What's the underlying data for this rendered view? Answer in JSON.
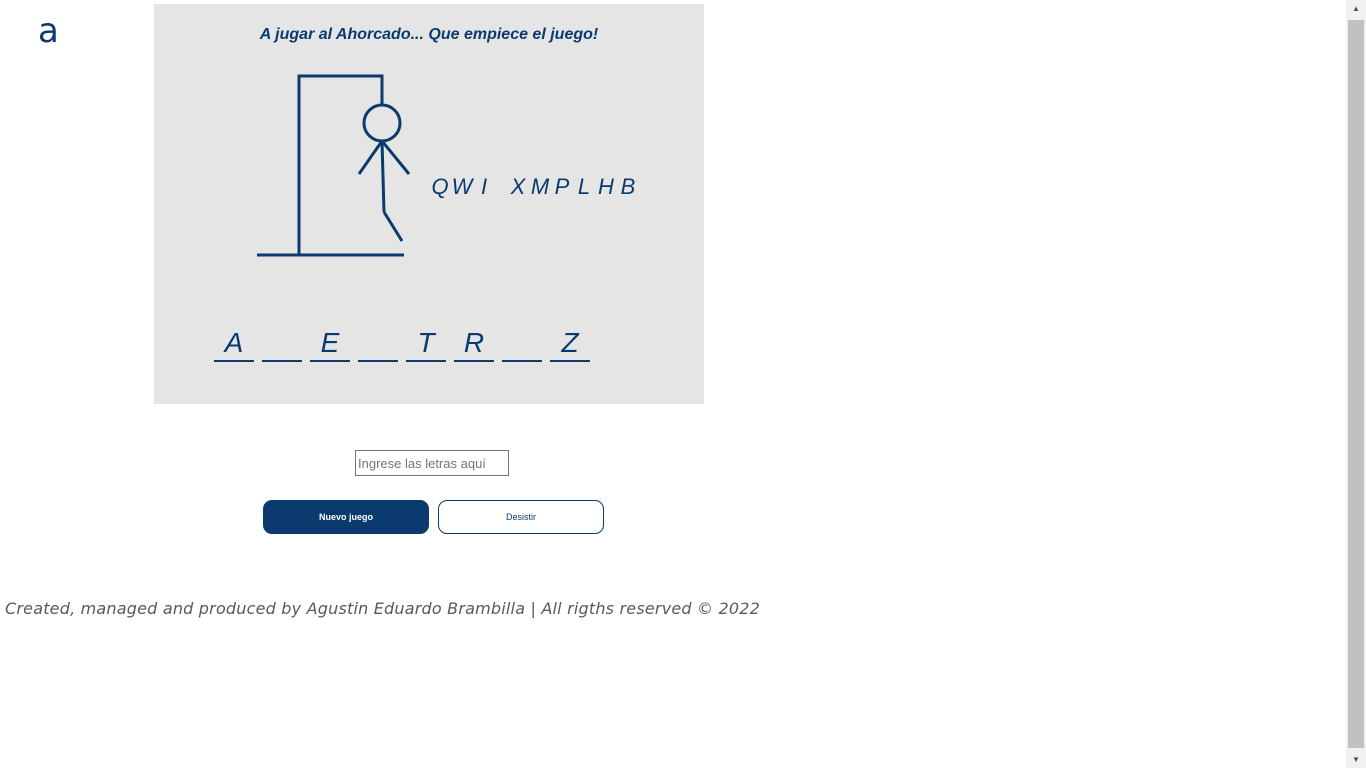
{
  "logo": {
    "text": "a"
  },
  "game": {
    "title": "A jugar al Ahorcado... Que empiece el juego!",
    "wrong_letters": [
      "Q",
      "W",
      "I",
      "",
      "X",
      "M",
      "P",
      "L",
      "H",
      "B"
    ],
    "word_slots": [
      "A",
      "",
      "E",
      "",
      "T",
      "R",
      "",
      "Z"
    ]
  },
  "controls": {
    "input_placeholder": "Ingrese las letras aquí",
    "new_game_label": "Nuevo juego",
    "give_up_label": "Desistir"
  },
  "footer": {
    "text": "Created, managed and produced by Agustin Eduardo Brambilla | All rigths reserved © 2022"
  },
  "colors": {
    "accent": "#0b3a6e",
    "panel_bg": "#e5e5e6"
  }
}
